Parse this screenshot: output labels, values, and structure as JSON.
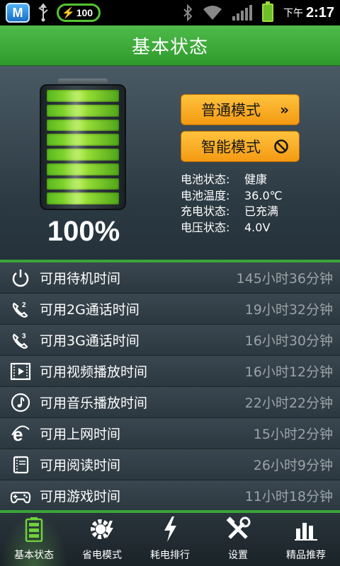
{
  "status_bar": {
    "app_badge": "M",
    "battery_pill": "100",
    "time_prefix": "下午",
    "time": "2:17"
  },
  "title": "基本状态",
  "battery": {
    "percent_text": "100%",
    "level": 1.0,
    "segments": 8,
    "color": "#8fdc2f"
  },
  "modes": {
    "normal": {
      "label": "普通模式",
      "icon": "double-chevron-right-icon"
    },
    "smart": {
      "label": "智能模式",
      "icon": "forbidden-icon"
    }
  },
  "info": [
    {
      "key": "电池状态:",
      "value": "健康"
    },
    {
      "key": "电池温度:",
      "value": "36.0℃"
    },
    {
      "key": "充电状态:",
      "value": "已充满"
    },
    {
      "key": "电压状态:",
      "value": "4.0V"
    }
  ],
  "usage": [
    {
      "label": "可用待机时间",
      "value": "145小时36分钟",
      "icon": "power-icon"
    },
    {
      "label": "可用2G通话时间",
      "value": "19小时32分钟",
      "icon": "phone-2g-icon"
    },
    {
      "label": "可用3G通话时间",
      "value": "16小时30分钟",
      "icon": "phone-3g-icon"
    },
    {
      "label": "可用视频播放时间",
      "value": "16小时12分钟",
      "icon": "video-icon"
    },
    {
      "label": "可用音乐播放时间",
      "value": "22小时22分钟",
      "icon": "music-icon"
    },
    {
      "label": "可用上网时间",
      "value": "15小时2分钟",
      "icon": "browser-icon"
    },
    {
      "label": "可用阅读时间",
      "value": "26小时9分钟",
      "icon": "book-icon"
    },
    {
      "label": "可用游戏时间",
      "value": "11小时18分钟",
      "icon": "gamepad-icon"
    }
  ],
  "nav": [
    {
      "label": "基本状态",
      "icon": "battery-tab-icon",
      "active": true
    },
    {
      "label": "省电模式",
      "icon": "gear-lightning-icon",
      "active": false
    },
    {
      "label": "耗电排行",
      "icon": "lightning-icon",
      "active": false
    },
    {
      "label": "设置",
      "icon": "tools-icon",
      "active": false
    },
    {
      "label": "精品推荐",
      "icon": "bar-chart-icon",
      "active": false
    }
  ],
  "colors": {
    "accent_green": "#3aa43a",
    "mode_button": "#f7a81e",
    "value_gray": "#9aa3a8"
  }
}
